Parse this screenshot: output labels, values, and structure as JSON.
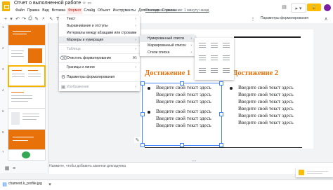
{
  "header": {
    "doc_title": "Отчет о выполненной работе",
    "last_edit": "Последнее изменение: 1 минуту назад",
    "present_label": "",
    "share_label": "",
    "avatar_letter": "",
    "menus": [
      "Файл",
      "Правка",
      "Вид",
      "Вставка",
      "Формат",
      "Слайд",
      "Объект",
      "Инструменты",
      "Дополнения",
      "Справка"
    ],
    "active_menu": "Формат"
  },
  "toolbar": {
    "options_label": "Параметры форматирования"
  },
  "filmstrip": {
    "slide_numbers": [
      "1",
      "2",
      "3",
      "4",
      "5",
      "6",
      "7"
    ],
    "selected_slide": "3"
  },
  "slide": {
    "left_title": "Достижение 1",
    "right_title": "Достижение 2",
    "placeholder_text": "Введите свой текст здесь"
  },
  "format_menu": {
    "items": [
      {
        "label": "Текст",
        "submenu": true,
        "disabled": false
      },
      {
        "label": "Выравнивание и отступы",
        "submenu": true,
        "disabled": false
      },
      {
        "label": "Интервалы между абзацами или строками",
        "submenu": true,
        "disabled": false
      },
      {
        "label": "Маркеры и нумерация",
        "submenu": true,
        "disabled": false
      },
      {
        "label": "Таблица",
        "submenu": true,
        "disabled": true
      },
      {
        "label": "Очистить форматирование",
        "shortcut": "⌘\\",
        "disabled": false
      },
      {
        "label": "Границы и линии",
        "submenu": true,
        "disabled": false
      },
      {
        "label": "Параметры форматирования",
        "disabled": false
      },
      {
        "label": "Изображение",
        "submenu": true,
        "disabled": true
      }
    ]
  },
  "bullets_submenu": {
    "items": [
      {
        "label": "Нумерованный список",
        "submenu": true
      },
      {
        "label": "Маркированный список",
        "submenu": true
      },
      {
        "label": "Стили списка",
        "submenu": true
      }
    ]
  },
  "notes": {
    "hint": "Нажмите, чтобы добавить заметки докладчика"
  },
  "download_bar": {
    "file_name": "chamerd.k_profile.jpg"
  },
  "colors": {
    "accent_orange": "#e8710a",
    "logo_yellow": "#f4b400",
    "selection_blue": "#4285f4",
    "active_menu_bg": "#fce8e6"
  }
}
